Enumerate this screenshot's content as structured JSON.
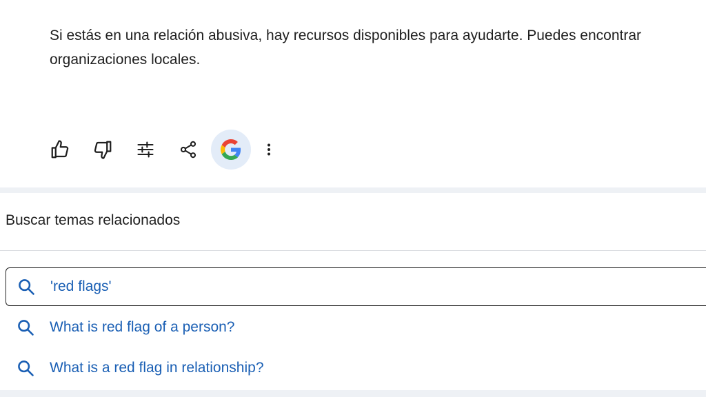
{
  "response": {
    "line1": "Si estás en una relación abusiva, hay recursos disponibles para ayudarte. Puedes encontrar",
    "line2": "organizaciones locales."
  },
  "toolbar": {
    "buttons": [
      {
        "name": "thumbs-up-icon"
      },
      {
        "name": "thumbs-down-icon"
      },
      {
        "name": "modify-response-icon"
      },
      {
        "name": "share-icon"
      },
      {
        "name": "google-check-icon",
        "active": true
      },
      {
        "name": "more-vert-icon"
      }
    ]
  },
  "related": {
    "title": "Buscar temas relacionados",
    "suggestions": [
      {
        "text": "'red flags'",
        "selected": true
      },
      {
        "text": "What is red flag of a person?",
        "selected": false
      },
      {
        "text": "What is a red flag in relationship?",
        "selected": false
      }
    ]
  },
  "colors": {
    "text": "#1f1f1f",
    "link": "#1a5fb4",
    "active_bg": "#e3ecf8",
    "band": "#eef1f5"
  }
}
